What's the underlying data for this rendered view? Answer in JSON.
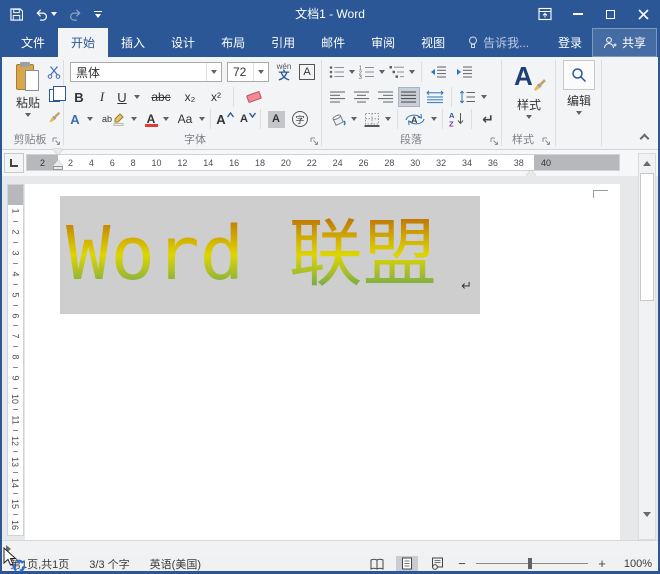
{
  "window": {
    "title": "文档1 - Word"
  },
  "tabs": {
    "items": [
      "文件",
      "开始",
      "插入",
      "设计",
      "布局",
      "引用",
      "邮件",
      "审阅",
      "视图"
    ],
    "active": "开始",
    "tell_me": "告诉我...",
    "sign_in": "登录",
    "share": "共享"
  },
  "ribbon": {
    "clipboard": {
      "label": "剪贴板",
      "paste": "粘贴"
    },
    "font": {
      "label": "字体",
      "name": "黑体",
      "size": "72",
      "bold": "B",
      "italic": "I",
      "underline": "U",
      "strike": "abc",
      "subscript": "x₂",
      "superscript": "x²",
      "phonetic_top": "wén",
      "phonetic_char": "文",
      "border_char": "A",
      "effects_char": "A",
      "highlight_chars": "ab",
      "color_char": "A",
      "case_chars": "Aa",
      "grow_char": "A",
      "shrink_char": "A",
      "shading_char": "A",
      "enclose_char": "字"
    },
    "paragraph": {
      "label": "段落",
      "sort_a": "A",
      "sort_z": "Z",
      "mark_char": "↵"
    },
    "styles": {
      "label": "样式",
      "button": "样式",
      "icon_char": "A"
    },
    "editing": {
      "button": "编辑"
    }
  },
  "ruler": {
    "left_margin": "2",
    "right_margin": "40",
    "h_numbers": [
      "2",
      "4",
      "6",
      "8",
      "10",
      "12",
      "14",
      "16",
      "18",
      "20",
      "22",
      "24",
      "26",
      "28",
      "30",
      "32",
      "34",
      "36",
      "38"
    ],
    "v_numbers": [
      "1",
      "2",
      "3",
      "4",
      "5",
      "6",
      "7",
      "8",
      "9",
      "10",
      "11",
      "12",
      "13",
      "14",
      "15",
      "16"
    ]
  },
  "document": {
    "text": "Word 联盟",
    "paragraph_mark": "↵",
    "selection_color": "#cecece",
    "gradient_colors": [
      "#a94e0e",
      "#ddd600",
      "#3a8f66"
    ]
  },
  "status": {
    "page": "第1页,共1页",
    "words": "3/3 个字",
    "language": "英语(美国)",
    "zoom_out": "−",
    "zoom_in": "+",
    "zoom": "100%"
  },
  "colors": {
    "accent": "#2b5797",
    "ribbon_bg": "#f3f4f6",
    "font_color_swatch": "#e03c31"
  }
}
